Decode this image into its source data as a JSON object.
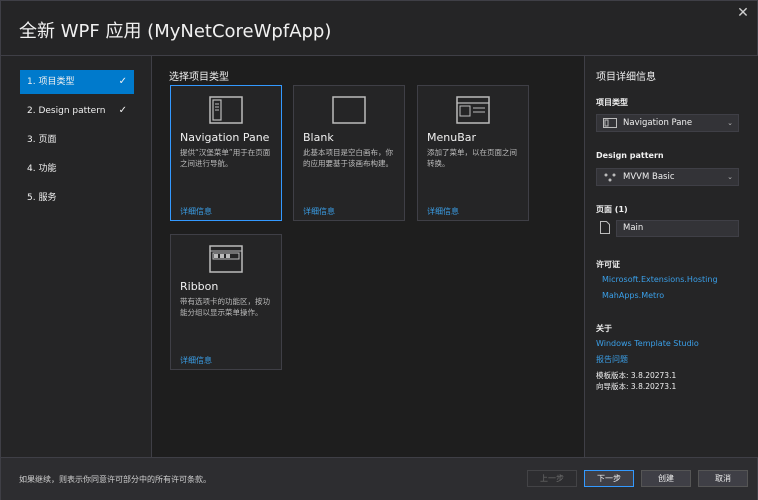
{
  "window": {
    "title": "全新 WPF 应用 (MyNetCoreWpfApp)",
    "close_glyph": "✕"
  },
  "steps": [
    {
      "label": "1. 项目类型",
      "checked": true,
      "active": true
    },
    {
      "label": "2. Design pattern",
      "checked": true,
      "active": false
    },
    {
      "label": "3. 页面",
      "checked": false,
      "active": false
    },
    {
      "label": "4. 功能",
      "checked": false,
      "active": false
    },
    {
      "label": "5. 服务",
      "checked": false,
      "active": false
    }
  ],
  "check_glyph": "✓",
  "center": {
    "section_title": "选择项目类型",
    "cards": [
      {
        "name": "Navigation Pane",
        "desc": "提供“汉堡菜单”用于在页面之间进行导航。",
        "more": "详细信息",
        "icon": "navigation-pane-icon"
      },
      {
        "name": "Blank",
        "desc": "此基本项目是空白画布，你的应用要基于该画布构建。",
        "more": "详细信息",
        "icon": "blank-icon"
      },
      {
        "name": "MenuBar",
        "desc": "添加了菜单，以在页面之间转换。",
        "more": "详细信息",
        "icon": "menubar-icon"
      },
      {
        "name": "Ribbon",
        "desc": "带有选项卡的功能区，按功能分组以显示菜单操作。",
        "more": "详细信息",
        "icon": "ribbon-icon"
      }
    ]
  },
  "details": {
    "title": "项目详细信息",
    "project_type_label": "项目类型",
    "project_type_value": "Navigation Pane",
    "design_pattern_label": "Design pattern",
    "design_pattern_value": "MVVM Basic",
    "pages_label": "页面 (1)",
    "page_value": "Main",
    "license_label": "许可证",
    "licenses": [
      "Microsoft.Extensions.Hosting",
      "MahApps.Metro"
    ],
    "about_label": "关于",
    "about_link": "Windows Template Studio",
    "report_link": "报告问题",
    "template_version": "模板版本: 3.8.20273.1",
    "wizard_version": "向导版本: 3.8.20273.1"
  },
  "footer": {
    "notice": "如果继续，则表示你同意许可部分中的所有许可条款。",
    "prev": "上一步",
    "next": "下一步",
    "create": "创建",
    "cancel": "取消"
  },
  "colors": {
    "accent": "#007acc",
    "link": "#3a9fe8",
    "selected_border": "#3399ff"
  }
}
